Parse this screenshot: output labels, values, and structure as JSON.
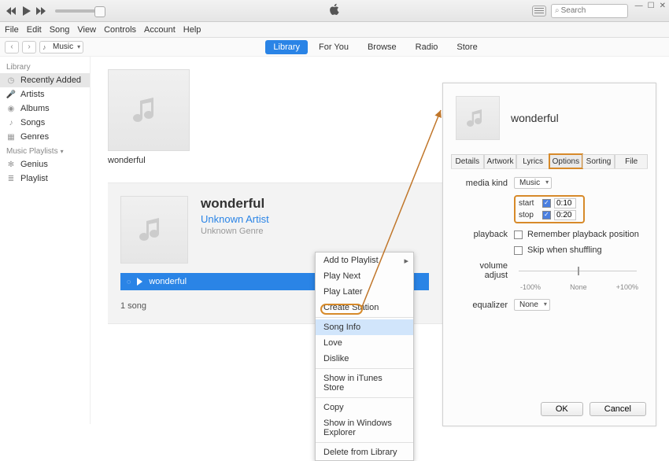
{
  "titlebar": {
    "search_placeholder": "Search"
  },
  "menubar": [
    "File",
    "Edit",
    "Song",
    "View",
    "Controls",
    "Account",
    "Help"
  ],
  "subbar": {
    "library_selector": "Music"
  },
  "tabs": [
    "Library",
    "For You",
    "Browse",
    "Radio",
    "Store"
  ],
  "active_tab": "Library",
  "sidebar": {
    "library_head": "Library",
    "playlists_head": "Music Playlists",
    "library": [
      {
        "icon": "clock",
        "label": "Recently Added",
        "selected": true
      },
      {
        "icon": "mic",
        "label": "Artists"
      },
      {
        "icon": "disc",
        "label": "Albums"
      },
      {
        "icon": "note",
        "label": "Songs"
      },
      {
        "icon": "grid",
        "label": "Genres"
      }
    ],
    "playlists": [
      {
        "icon": "atom",
        "label": "Genius"
      },
      {
        "icon": "list",
        "label": "Playlist"
      }
    ]
  },
  "tile": {
    "label": "wonderful"
  },
  "detail": {
    "title": "wonderful",
    "artist": "Unknown Artist",
    "genre": "Unknown Genre",
    "track": "wonderful",
    "count": "1 song"
  },
  "ctxmenu": [
    {
      "label": "Add to Playlist",
      "sub": true
    },
    {
      "label": "Play Next"
    },
    {
      "label": "Play Later"
    },
    {
      "label": "Create Station"
    },
    {
      "sep": true
    },
    {
      "label": "Song Info",
      "sel": true
    },
    {
      "label": "Love"
    },
    {
      "label": "Dislike"
    },
    {
      "sep": true
    },
    {
      "label": "Show in iTunes Store"
    },
    {
      "sep": true
    },
    {
      "label": "Copy"
    },
    {
      "label": "Show in Windows Explorer"
    },
    {
      "sep": true
    },
    {
      "label": "Delete from Library"
    }
  ],
  "infodlg": {
    "title": "wonderful",
    "tabs": [
      "Details",
      "Artwork",
      "Lyrics",
      "Options",
      "Sorting",
      "File"
    ],
    "active_tab": "Options",
    "media_kind_label": "media kind",
    "media_kind": "Music",
    "start_label": "start",
    "stop_label": "stop",
    "start_val": "0:10",
    "stop_val": "0:20",
    "playback_label": "playback",
    "remember": "Remember playback position",
    "skip": "Skip when shuffling",
    "vol_label": "volume adjust",
    "vol_ticks": [
      "-100%",
      "None",
      "+100%"
    ],
    "eq_label": "equalizer",
    "eq_val": "None",
    "ok": "OK",
    "cancel": "Cancel"
  }
}
